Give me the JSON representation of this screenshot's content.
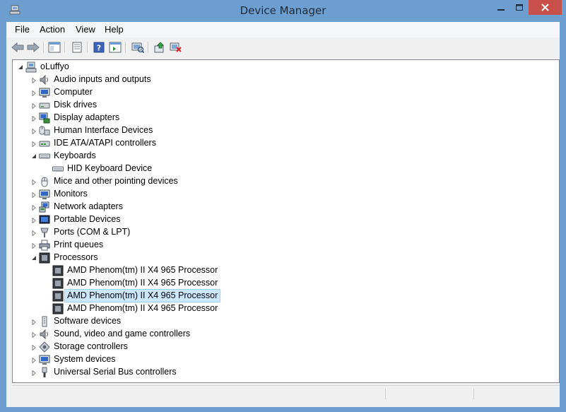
{
  "window": {
    "title": "Device Manager"
  },
  "menu": [
    "File",
    "Action",
    "View",
    "Help"
  ],
  "toolbar": [
    "back-icon",
    "forward-icon",
    "show-hide-console-tree-icon",
    "properties-icon",
    "help-icon",
    "action-pane-icon",
    "scan-hardware-icon",
    "update-driver-icon",
    "uninstall-device-icon"
  ],
  "tree": {
    "root": "oLuffyo",
    "items": [
      {
        "label": "Audio inputs and outputs"
      },
      {
        "label": "Computer"
      },
      {
        "label": "Disk drives"
      },
      {
        "label": "Display adapters"
      },
      {
        "label": "Human Interface Devices"
      },
      {
        "label": "IDE ATA/ATAPI controllers"
      },
      {
        "label": "Keyboards",
        "children": [
          "HID Keyboard Device"
        ]
      },
      {
        "label": "Mice and other pointing devices"
      },
      {
        "label": "Monitors"
      },
      {
        "label": "Network adapters"
      },
      {
        "label": "Portable Devices"
      },
      {
        "label": "Ports (COM & LPT)"
      },
      {
        "label": "Print queues"
      },
      {
        "label": "Processors",
        "children": [
          "AMD Phenom(tm) II X4 965 Processor",
          "AMD Phenom(tm) II X4 965 Processor",
          "AMD Phenom(tm) II X4 965 Processor",
          "AMD Phenom(tm) II X4 965 Processor"
        ]
      },
      {
        "label": "Software devices"
      },
      {
        "label": "Sound, video and game controllers"
      },
      {
        "label": "Storage controllers"
      },
      {
        "label": "System devices"
      },
      {
        "label": "Universal Serial Bus controllers"
      }
    ]
  }
}
